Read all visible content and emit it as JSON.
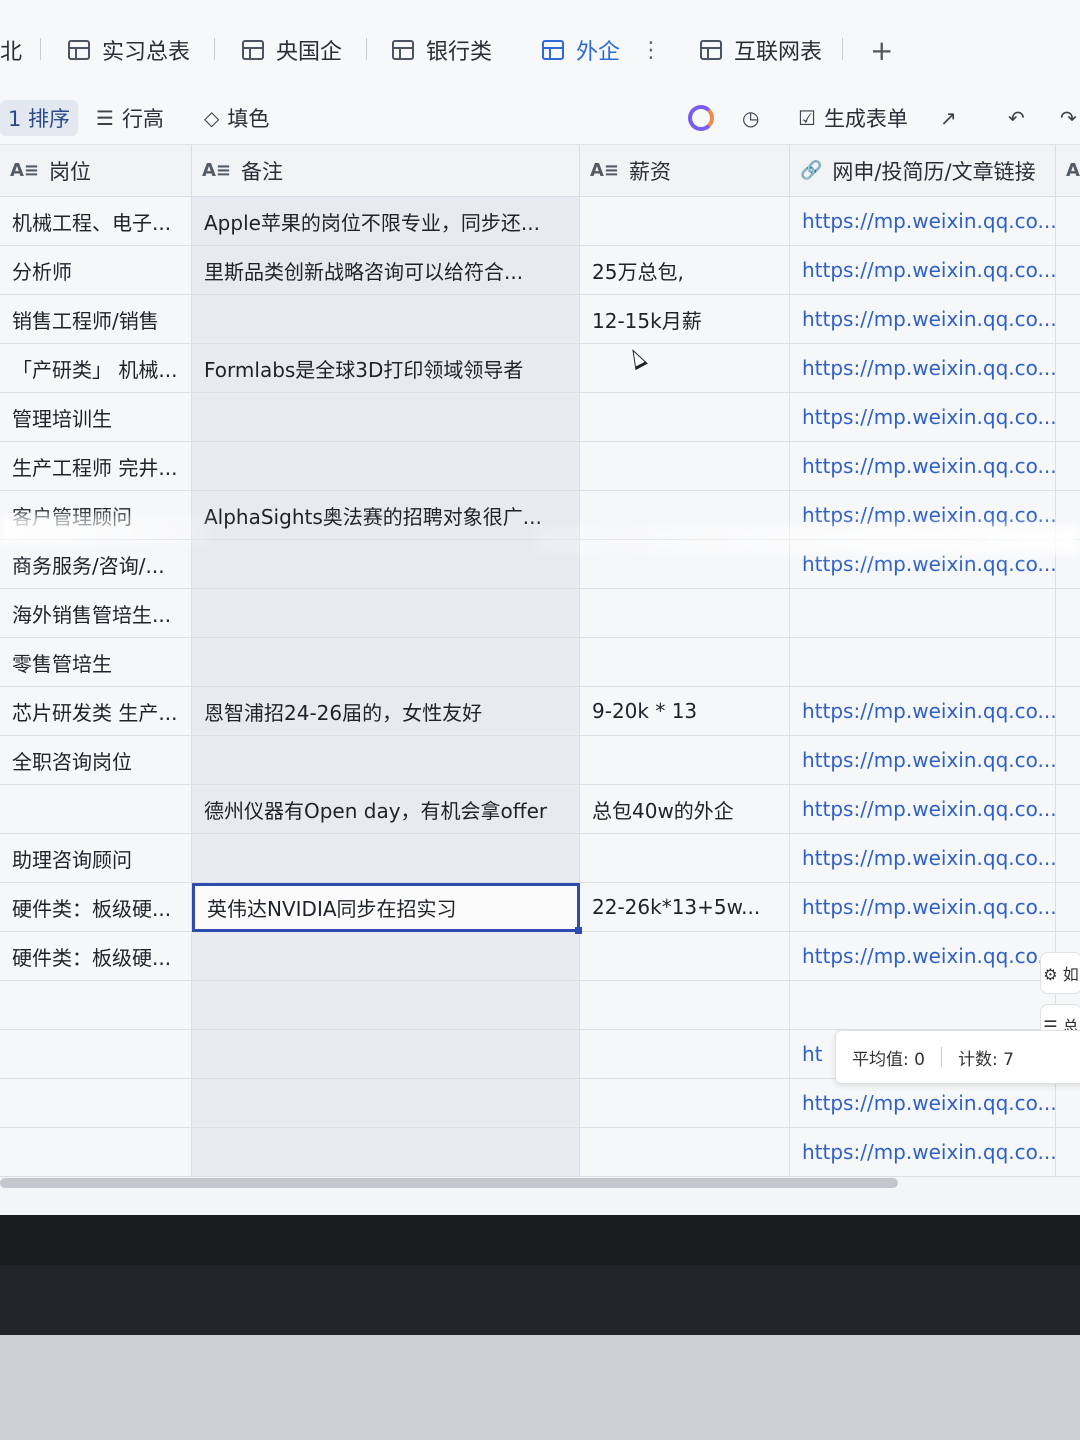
{
  "tabs": [
    {
      "label": "北",
      "active": false
    },
    {
      "label": "实习总表",
      "active": false
    },
    {
      "label": "央国企",
      "active": false
    },
    {
      "label": "银行类",
      "active": false
    },
    {
      "label": "外企",
      "active": true
    },
    {
      "label": "互联网表",
      "active": false
    }
  ],
  "tab_more": "⋮",
  "tab_add": "+",
  "toolbar": {
    "sort": "1 排序",
    "row_height": "行高",
    "fill_color": "填色",
    "generate_form": "生成表单"
  },
  "columns": [
    {
      "type_icon": "A≡",
      "label": "岗位"
    },
    {
      "type_icon": "A≡",
      "label": "备注"
    },
    {
      "type_icon": "A≡",
      "label": "薪资"
    },
    {
      "type_icon": "🔗",
      "label": "网申/投简历/文章链接"
    },
    {
      "type_icon": "A≡",
      "label": ""
    }
  ],
  "rows": [
    {
      "position": "机械工程、电子...",
      "note": "Apple苹果的岗位不限专业，同步还...",
      "salary": "",
      "link": "https://mp.weixin.qq.co..."
    },
    {
      "position": "分析师",
      "note": "里斯品类创新战略咨询可以给符合...",
      "salary": "25万总包,",
      "link": "https://mp.weixin.qq.co..."
    },
    {
      "position": "销售工程师/销售",
      "note": "",
      "salary": "12-15k月薪",
      "link": "https://mp.weixin.qq.co..."
    },
    {
      "position": "「产研类」 机械...",
      "note": "Formlabs是全球3D打印领域领导者",
      "salary": "",
      "link": "https://mp.weixin.qq.co..."
    },
    {
      "position": "管理培训生",
      "note": "",
      "salary": "",
      "link": "https://mp.weixin.qq.co..."
    },
    {
      "position": "生产工程师 完井...",
      "note": "",
      "salary": "",
      "link": "https://mp.weixin.qq.co..."
    },
    {
      "position": "客户管理顾问",
      "note": "AlphaSights奥法赛的招聘对象很广...",
      "salary": "",
      "link": "https://mp.weixin.qq.co..."
    },
    {
      "position": "商务服务/咨询/...",
      "note": "",
      "salary": "",
      "link": "https://mp.weixin.qq.co..."
    },
    {
      "position": "海外销售管培生...",
      "note": "",
      "salary": "",
      "link": ""
    },
    {
      "position": "零售管培生",
      "note": "",
      "salary": "",
      "link": ""
    },
    {
      "position": "芯片研发类 生产...",
      "note": "恩智浦招24-26届的，女性友好",
      "salary": "9-20k * 13",
      "link": "https://mp.weixin.qq.co..."
    },
    {
      "position": "全职咨询岗位",
      "note": "",
      "salary": "",
      "link": "https://mp.weixin.qq.co..."
    },
    {
      "position": "",
      "note": "德州仪器有Open day，有机会拿offer",
      "salary": "总包40w的外企",
      "link": "https://mp.weixin.qq.co..."
    },
    {
      "position": "助理咨询顾问",
      "note": "",
      "salary": "",
      "link": "https://mp.weixin.qq.co..."
    },
    {
      "position": "硬件类：板级硬...",
      "note": "英伟达NVIDIA同步在招实习",
      "salary": "22-26k*13+5w...",
      "link": "https://mp.weixin.qq.co..."
    },
    {
      "position": "硬件类：板级硬...",
      "note": "",
      "salary": "",
      "link": "https://mp.weixin.qq.co..."
    },
    {
      "position": "",
      "note": "",
      "salary": "",
      "link": ""
    },
    {
      "position": "",
      "note": "",
      "salary": "",
      "link": "ht"
    },
    {
      "position": "",
      "note": "",
      "salary": "",
      "link": "https://mp.weixin.qq.co..."
    },
    {
      "position": "",
      "note": "",
      "salary": "",
      "link": "https://mp.weixin.qq.co..."
    }
  ],
  "status": {
    "average": "平均值: 0",
    "count": "计数: 7"
  },
  "side_buttons": [
    "⚙ 如",
    "☰ 总"
  ],
  "colors": {
    "accent": "#2f6bd8",
    "link": "#2e61c7",
    "selection": "#2f4bb0"
  }
}
